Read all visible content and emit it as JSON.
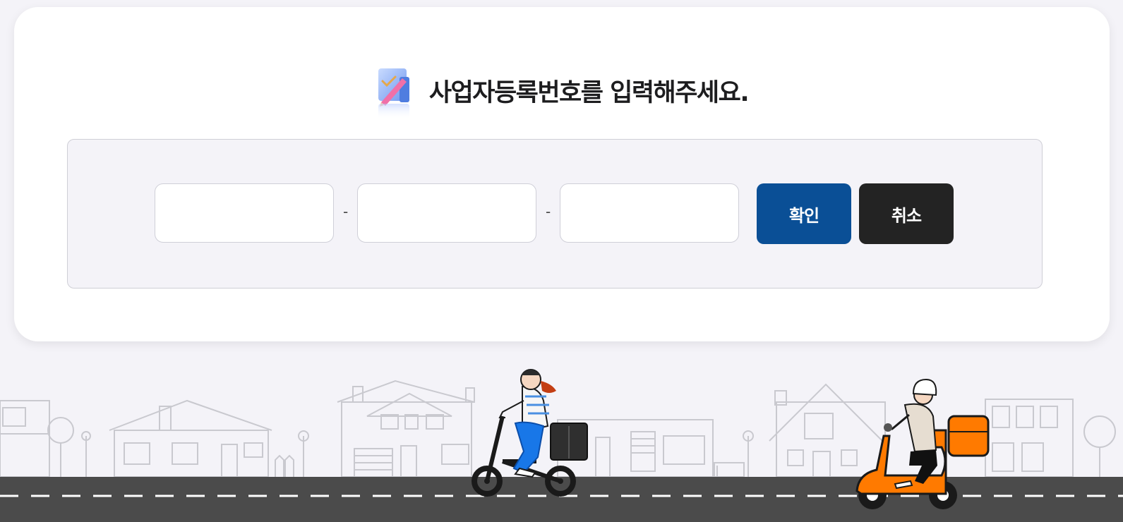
{
  "page": {
    "title": "사업자등록번호를 입력해주세요.",
    "title_icon": "document-pencil-icon"
  },
  "form": {
    "field1": {
      "value": "",
      "placeholder": ""
    },
    "field2": {
      "value": "",
      "placeholder": ""
    },
    "field3": {
      "value": "",
      "placeholder": ""
    },
    "separator": "-"
  },
  "buttons": {
    "confirm_label": "확인",
    "cancel_label": "취소"
  },
  "colors": {
    "confirm": "#0a4f96",
    "cancel": "#232323",
    "road": "#4b4b4b",
    "scooter": "#ff7a00"
  }
}
